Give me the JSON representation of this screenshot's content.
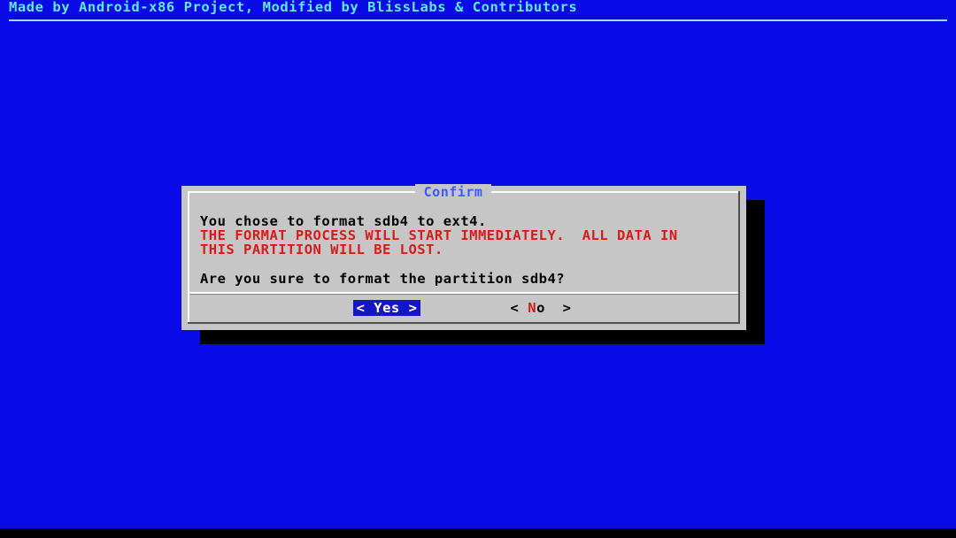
{
  "backtitle": "Made by Android-x86 Project, Modified by BlissLabs & Contributors",
  "dialog": {
    "title": "Confirm",
    "message_line1": "You chose to format sdb4 to ext4.",
    "warning_line1": "THE FORMAT PROCESS WILL START IMMEDIATELY.  ALL DATA IN",
    "warning_line2": "THIS PARTITION WILL BE LOST.",
    "question": "Are you sure to format the partition sdb4?"
  },
  "buttons": {
    "yes": {
      "left_bracket": "<",
      "label": "Yes",
      "right_bracket": ">",
      "selected": true
    },
    "no": {
      "left_bracket": "<",
      "hotkey": "N",
      "label_rest": "o",
      "right_bracket": ">",
      "selected": false
    }
  },
  "colors": {
    "background": "#0a0ae6",
    "backtitle": "#5fe8f5",
    "dialog": "#c6c6c6",
    "title": "#3b5bff",
    "warning": "#d81a1a",
    "selected_button": "#1515c8"
  }
}
